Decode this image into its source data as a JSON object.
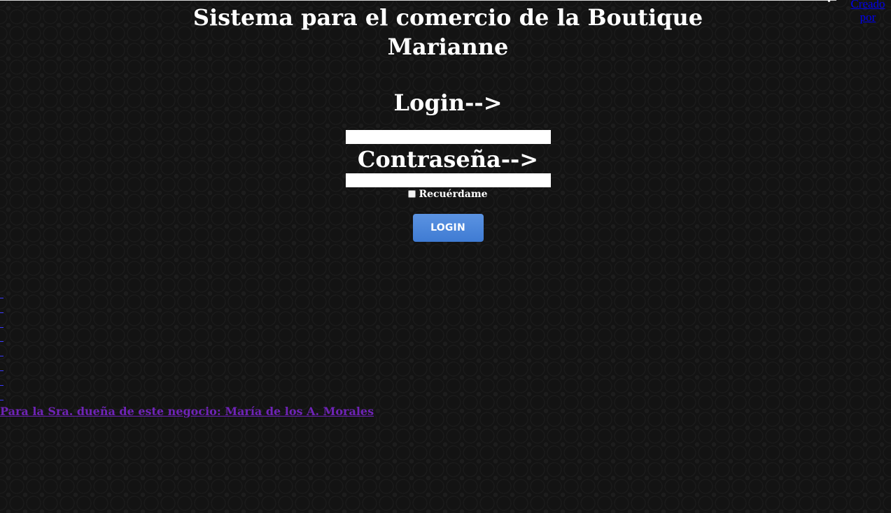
{
  "header": {
    "credit_link": "Creado por",
    "credit_bullet": "•"
  },
  "page": {
    "title": "Sistema para el comercio de la Boutique Marianne"
  },
  "login_form": {
    "login_label": "Login-->",
    "login_value": "",
    "password_label": "Contraseña-->",
    "password_value": "",
    "remember_label": "Recuérdame",
    "remember_checked": false,
    "submit_label": "LOGIN",
    "button_color": "#4a86db"
  },
  "footer": {
    "dash_links": [
      "_",
      "_",
      "_",
      "_",
      "_",
      "_",
      "_",
      "_"
    ],
    "dedication": "Para la Sra. dueña de este negocio: María de los A. Morales"
  },
  "colors": {
    "background": "#131313",
    "text": "#ffffff",
    "link_unvisited": "#0000ee",
    "link_visited": "#6f23b7"
  }
}
